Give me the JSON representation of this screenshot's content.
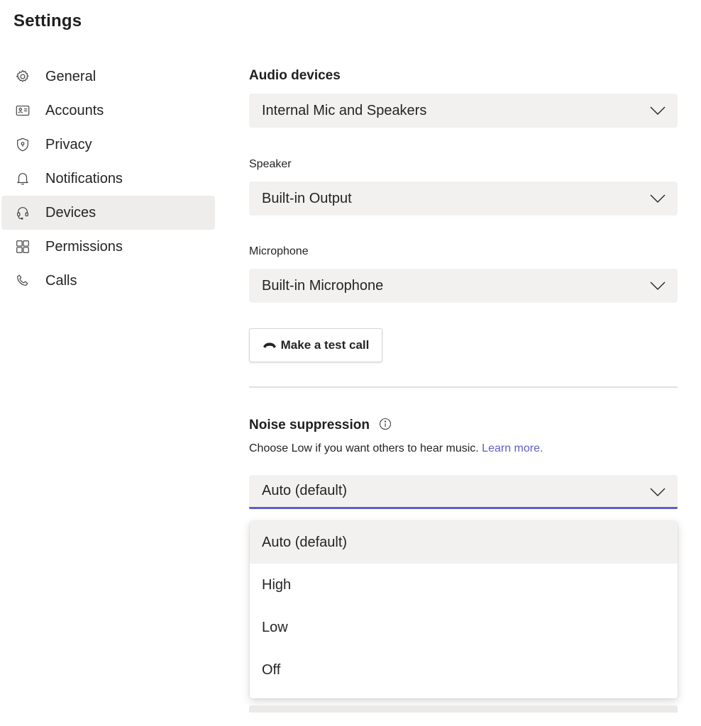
{
  "page": {
    "title": "Settings"
  },
  "sidebar": {
    "items": [
      {
        "label": "General",
        "icon": "gear-icon",
        "active": false
      },
      {
        "label": "Accounts",
        "icon": "id-card-icon",
        "active": false
      },
      {
        "label": "Privacy",
        "icon": "shield-lock-icon",
        "active": false
      },
      {
        "label": "Notifications",
        "icon": "bell-icon",
        "active": false
      },
      {
        "label": "Devices",
        "icon": "headset-icon",
        "active": true
      },
      {
        "label": "Permissions",
        "icon": "grid-icon",
        "active": false
      },
      {
        "label": "Calls",
        "icon": "phone-icon",
        "active": false
      }
    ]
  },
  "audio": {
    "heading": "Audio devices",
    "device_value": "Internal Mic and Speakers",
    "speaker_label": "Speaker",
    "speaker_value": "Built-in Output",
    "microphone_label": "Microphone",
    "microphone_value": "Built-in Microphone",
    "test_call_label": "Make a test call"
  },
  "noise": {
    "heading": "Noise suppression",
    "description": "Choose Low if you want others to hear music.",
    "link": "Learn more.",
    "value": "Auto (default)",
    "options": [
      "Auto (default)",
      "High",
      "Low",
      "Off"
    ],
    "highlighted_option": "Auto (default)"
  },
  "colors": {
    "accent": "#5b5fc7",
    "active_nav_bg": "#efedeb",
    "dropdown_bg": "#f2f1f0"
  }
}
